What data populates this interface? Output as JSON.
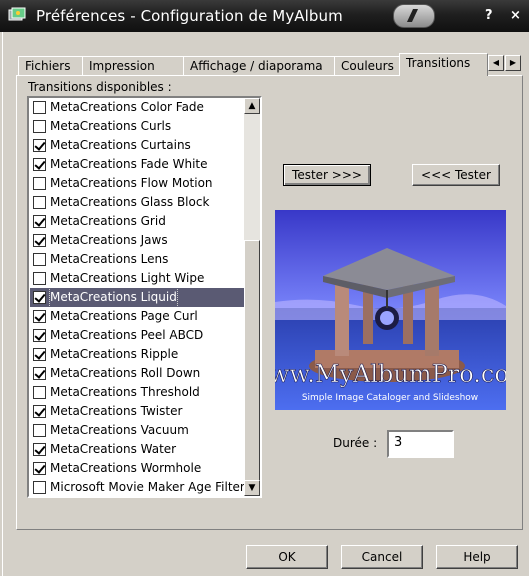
{
  "window": {
    "title": "Préférences - Configuration de MyAlbum",
    "help_glyph": "?",
    "close_glyph": "×"
  },
  "tabs": [
    {
      "label": "Fichiers"
    },
    {
      "label": "Impression"
    },
    {
      "label": "Affichage / diaporama"
    },
    {
      "label": "Couleurs"
    },
    {
      "label": "Transitions",
      "active": true
    }
  ],
  "transitions_label": "Transitions disponibles :",
  "transitions": [
    {
      "label": "MetaCreations Color Fade",
      "checked": false
    },
    {
      "label": "MetaCreations Curls",
      "checked": false
    },
    {
      "label": "MetaCreations Curtains",
      "checked": true
    },
    {
      "label": "MetaCreations Fade White",
      "checked": true
    },
    {
      "label": "MetaCreations Flow Motion",
      "checked": false
    },
    {
      "label": "MetaCreations Glass Block",
      "checked": false
    },
    {
      "label": "MetaCreations Grid",
      "checked": true
    },
    {
      "label": "MetaCreations Jaws",
      "checked": true
    },
    {
      "label": "MetaCreations Lens",
      "checked": false
    },
    {
      "label": "MetaCreations Light Wipe",
      "checked": false
    },
    {
      "label": "MetaCreations Liquid",
      "checked": true,
      "selected": true
    },
    {
      "label": "MetaCreations Page Curl",
      "checked": true
    },
    {
      "label": "MetaCreations Peel ABCD",
      "checked": true
    },
    {
      "label": "MetaCreations Ripple",
      "checked": true
    },
    {
      "label": "MetaCreations Roll Down",
      "checked": true
    },
    {
      "label": "MetaCreations Threshold",
      "checked": false
    },
    {
      "label": "MetaCreations Twister",
      "checked": true
    },
    {
      "label": "MetaCreations Vacuum",
      "checked": false
    },
    {
      "label": "MetaCreations Water",
      "checked": true
    },
    {
      "label": "MetaCreations Wormhole",
      "checked": true
    },
    {
      "label": "Microsoft Movie Maker Age Filter",
      "checked": false
    }
  ],
  "test_forward_button": "Tester >>>",
  "test_back_button": "<<< Tester",
  "preview": {
    "url_text": "www.MyAlbumPro.com",
    "tagline": "Simple Image Cataloger and Slideshow"
  },
  "duration": {
    "label": "Durée :",
    "value": "3"
  },
  "buttons": {
    "ok": "OK",
    "cancel": "Cancel",
    "help": "Help"
  },
  "colors": {
    "selection": "#5a5a73",
    "dialog": "#d4d0c8",
    "preview_sky": "#4d4dd9"
  }
}
